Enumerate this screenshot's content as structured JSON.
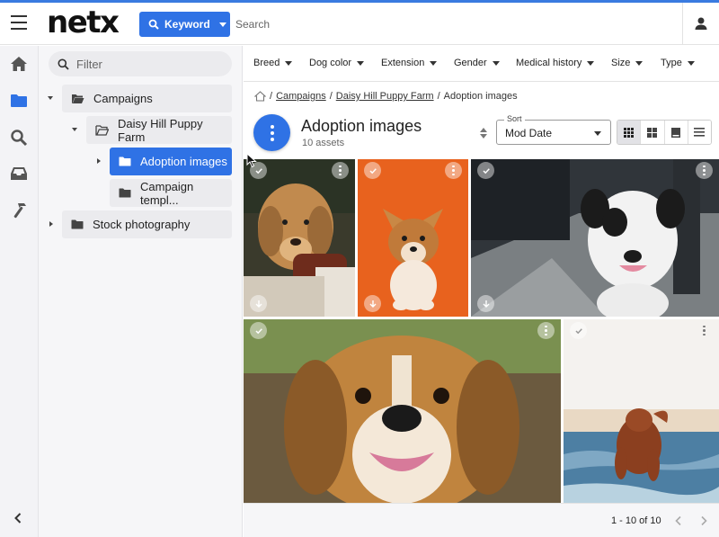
{
  "header": {
    "logo": "netx",
    "keyword_label": "Keyword",
    "search_placeholder": "Search"
  },
  "rail": {
    "icons": [
      "home-icon",
      "folder-icon",
      "search-icon",
      "inbox-icon",
      "hammer-icon"
    ]
  },
  "tree": {
    "filter_placeholder": "Filter",
    "items": [
      {
        "label": "Campaigns",
        "expanded": true
      },
      {
        "label": "Daisy Hill Puppy Farm",
        "expanded": true
      },
      {
        "label": "Adoption images",
        "selected": true
      },
      {
        "label": "Campaign templ..."
      },
      {
        "label": "Stock photography"
      }
    ]
  },
  "facets": [
    "Breed",
    "Dog color",
    "Extension",
    "Gender",
    "Medical history",
    "Size",
    "Type"
  ],
  "breadcrumb": {
    "parts": [
      "Campaigns",
      "Daisy Hill Puppy Farm"
    ],
    "current": "Adoption images",
    "separator": "/"
  },
  "folder": {
    "title": "Adoption images",
    "count": "10 assets"
  },
  "sort": {
    "label": "Sort",
    "value": "Mod Date"
  },
  "views": [
    "grid-small",
    "grid-large",
    "column",
    "list"
  ],
  "assets": [
    {
      "name": "golden-retriever-with-person",
      "colors": [
        "#8a6440",
        "#c49055",
        "#2d3a2a"
      ]
    },
    {
      "name": "corgi-puppy-orange-backdrop",
      "colors": [
        "#e8621e",
        "#c95519",
        "#fbe6cf"
      ]
    },
    {
      "name": "dalmatian-mix-on-sidewalk",
      "colors": [
        "#2c2f33",
        "#7c8486",
        "#f3f3f3"
      ]
    },
    {
      "name": "beagle-smiling-closeup",
      "colors": [
        "#6f8a4a",
        "#b47a3c",
        "#3b2a1c"
      ]
    },
    {
      "name": "retriever-running-on-beach",
      "colors": [
        "#e9e1d2",
        "#4a7ca0",
        "#8a4a2a"
      ]
    }
  ],
  "pagination": {
    "range": "1 - 10 of 10"
  },
  "accent": "#2f72e5"
}
